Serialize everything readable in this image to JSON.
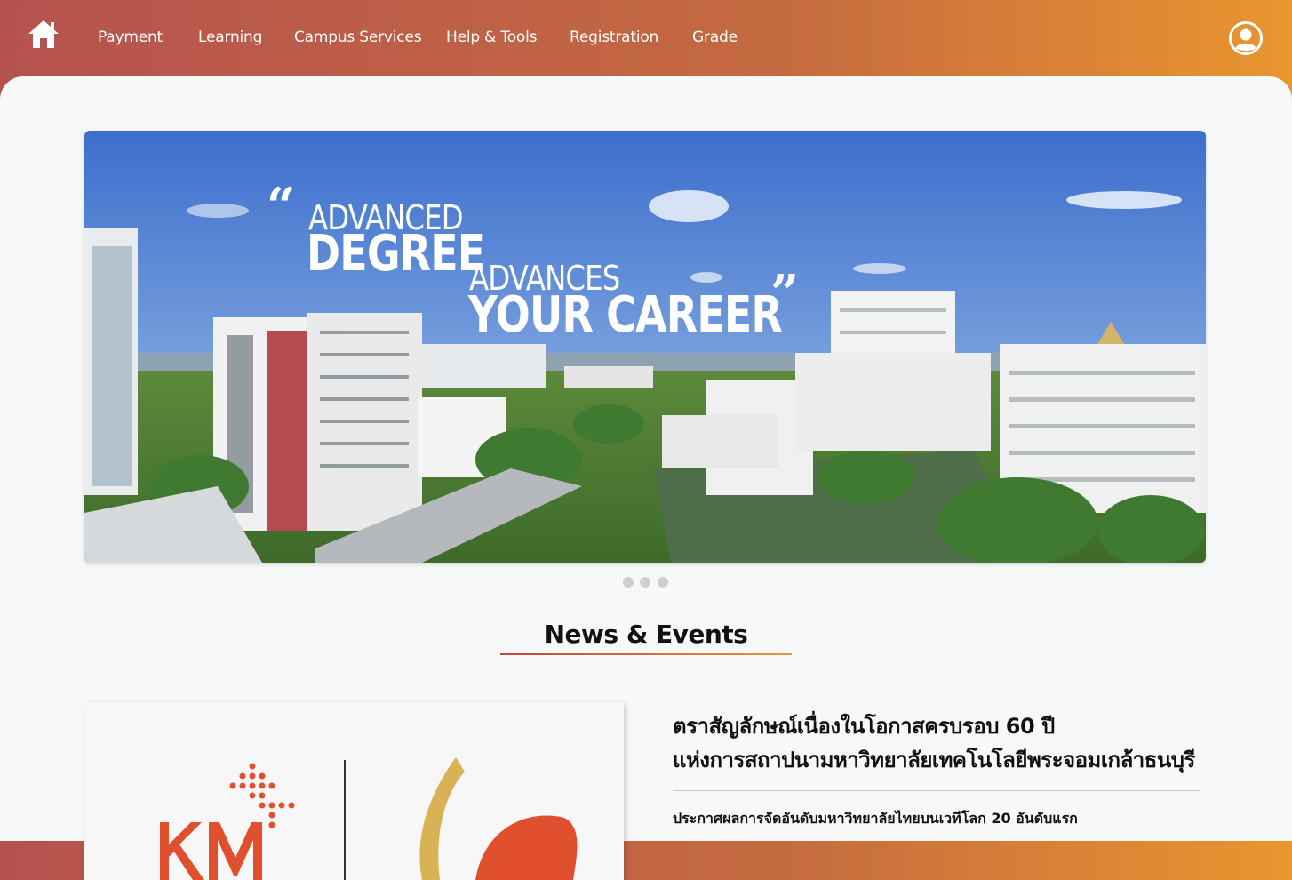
{
  "header": {
    "nav": [
      {
        "label": "Payment"
      },
      {
        "label": "Learning"
      },
      {
        "label": "Campus Services"
      },
      {
        "label": "Help & Tools"
      },
      {
        "label": "Registration"
      },
      {
        "label": "Grade"
      }
    ],
    "home_icon": "home-icon",
    "profile_icon": "user-circle-icon",
    "gradient": [
      "#b5524f",
      "#e8962f"
    ]
  },
  "banner": {
    "quote_open": "“",
    "quote_close": "”",
    "line1": "ADVANCED",
    "line2": "DEGREE",
    "line3": "ADVANCES",
    "line4": "YOUR CAREER",
    "slides": 3
  },
  "news": {
    "section_title": "News & Events",
    "headline_line1": "ตราสัญลักษณ์เนื่องในโอกาสครบรอบ 60 ปี",
    "headline_line2": "แห่งการสถาปนามหาวิทยาลัยเทคโนโลยีพระจอมเกล้าธนบุรี",
    "subheadline": "ประกาศผลการจัดอันดับมหาวิทยาลัยไทยบนเวทีโลก 20 อันดับแรก",
    "card_logo_text": "KM"
  }
}
